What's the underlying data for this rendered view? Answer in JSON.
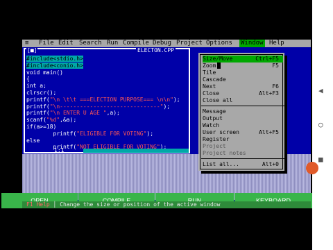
{
  "menubar": {
    "items": [
      "File",
      "Edit",
      "Search",
      "Run",
      "Compile",
      "Debug",
      "Project",
      "Options",
      "Window",
      "Help"
    ],
    "active": "Window"
  },
  "editor": {
    "close_glyph": "[■]",
    "filename": "ELECTON.CPP",
    "lines": [
      {
        "text": "#include<stdio.h>",
        "kind": "inc"
      },
      {
        "text": "#include<conio.h>",
        "kind": "inc"
      },
      {
        "text": "void main()",
        "kind": "code"
      },
      {
        "text": "{",
        "kind": "code"
      },
      {
        "text": "int a;",
        "kind": "code"
      },
      {
        "text": "clrscr();",
        "kind": "code"
      },
      {
        "text": "printf(\"\\n \\t\\t ===ELECTION PURPOSE=== \\n\\n\");",
        "kind": "code"
      },
      {
        "text": "printf(\"\\n------------------------------\");",
        "kind": "code"
      },
      {
        "text": "printf(\"\\n ENTER U AGE \",a);",
        "kind": "code"
      },
      {
        "text": "scanf(\"%d\",&a);",
        "kind": "code"
      },
      {
        "text": "if(a>=18)",
        "kind": "code"
      },
      {
        "text": "        printf(\"ELIGIBLE FOR VOTING\");",
        "kind": "code"
      },
      {
        "text": "else",
        "kind": "code"
      },
      {
        "text": "        printf(\"NOT ELIGIBLE FOR VOTING\");",
        "kind": "code"
      }
    ],
    "position": "1:1"
  },
  "window_menu": {
    "groups": [
      [
        {
          "label": "Size/Move",
          "shortcut": "Ctrl+F5",
          "selected": true
        },
        {
          "label": "Zoom",
          "shortcut": "F5",
          "cursor": true
        },
        {
          "label": "Tile",
          "shortcut": ""
        },
        {
          "label": "Cascade",
          "shortcut": ""
        },
        {
          "label": "Next",
          "shortcut": "F6"
        },
        {
          "label": "Close",
          "shortcut": "Alt+F3"
        },
        {
          "label": "Close all",
          "shortcut": ""
        }
      ],
      [
        {
          "label": "Message",
          "shortcut": ""
        },
        {
          "label": "Output",
          "shortcut": ""
        },
        {
          "label": "Watch",
          "shortcut": ""
        },
        {
          "label": "User screen",
          "shortcut": "Alt+F5"
        },
        {
          "label": "Register",
          "shortcut": ""
        },
        {
          "label": "Project",
          "shortcut": "",
          "disabled": true
        },
        {
          "label": "Project notes",
          "shortcut": "",
          "disabled": true
        }
      ],
      [
        {
          "label": "List all...",
          "shortcut": "Alt+0"
        }
      ]
    ]
  },
  "helpline": {
    "key": "F1 Help",
    "text": "Change the size or position of the active window"
  },
  "buttons": [
    "OPEN",
    "COMPILE",
    "RUN",
    "KEYBOARD"
  ],
  "nav": [
    "◀",
    "○",
    "■"
  ]
}
